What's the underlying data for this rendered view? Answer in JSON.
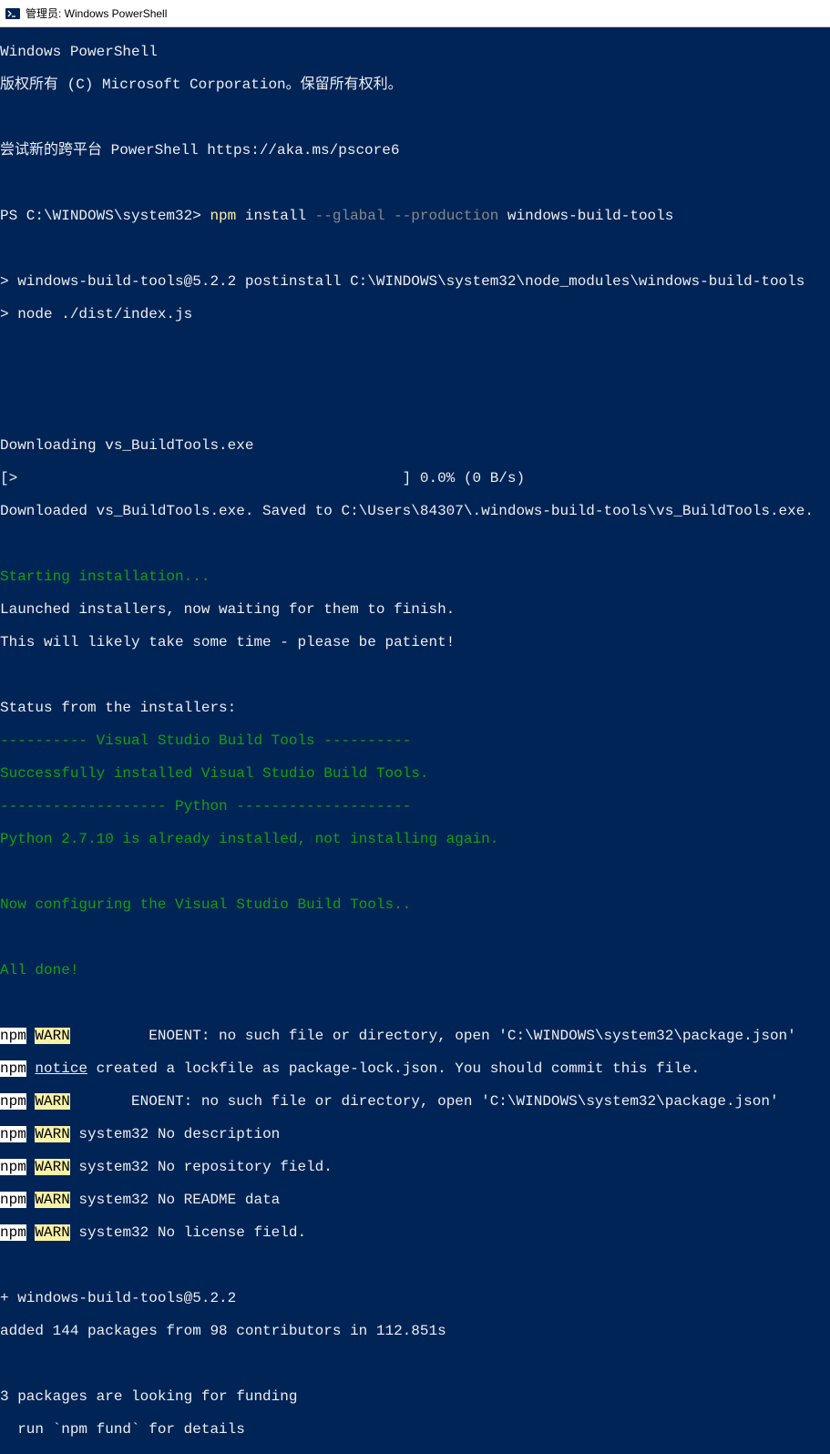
{
  "window": {
    "title": "管理员: Windows PowerShell"
  },
  "header": {
    "line1": "Windows PowerShell",
    "line2": "版权所有 (C) Microsoft Corporation。保留所有权利。",
    "line3": "尝试新的跨平台 PowerShell https://aka.ms/pscore6"
  },
  "prompt": {
    "ps": "PS C:\\WINDOWS\\system32> ",
    "cmd_npm": "npm",
    "cmd_rest1": " install ",
    "cmd_flags": "--glabal --production",
    "cmd_rest2": " windows-build-tools"
  },
  "postinstall": {
    "l1": "> windows-build-tools@5.2.2 postinstall C:\\WINDOWS\\system32\\node_modules\\windows-build-tools",
    "l2": "> node ./dist/index.js"
  },
  "download": {
    "l1": "Downloading vs_BuildTools.exe",
    "l2": "[>                                            ] 0.0% (0 B/s)",
    "l3": "Downloaded vs_BuildTools.exe. Saved to C:\\Users\\84307\\.windows-build-tools\\vs_BuildTools.exe."
  },
  "install": {
    "starting": "Starting installation...",
    "launched": "Launched installers, now waiting for them to finish.",
    "patient": "This will likely take some time - please be patient!",
    "status_hdr": "Status from the installers:",
    "vs_div": "---------- Visual Studio Build Tools ----------",
    "vs_ok": "Successfully installed Visual Studio Build Tools.",
    "py_div": "------------------- Python --------------------",
    "py_ok": "Python 2.7.10 is already installed, not installing again.",
    "config": "Now configuring the Visual Studio Build Tools..",
    "done": "All done!"
  },
  "npm": {
    "label": "npm",
    "warn": "WARN",
    "notice": "notice",
    "w1": " ENOENT: no such file or directory, open 'C:\\WINDOWS\\system32\\package.json'",
    "n1": " created a lockfile as package-lock.json. You should commit this file.",
    "w2": " ENOENT: no such file or directory, open 'C:\\WINDOWS\\system32\\package.json'",
    "w3": " system32 No description",
    "w4": " system32 No repository field.",
    "w5": " system32 No README data",
    "w6": " system32 No license field.",
    "pad1": "        ",
    "pad2": "      "
  },
  "result": {
    "plus": "+ windows-build-tools@5.2.2",
    "added": "added 144 packages from 98 contributors in 112.851s",
    "fund1": "3 packages are looking for funding",
    "fund2": "  run `npm fund` for details"
  }
}
